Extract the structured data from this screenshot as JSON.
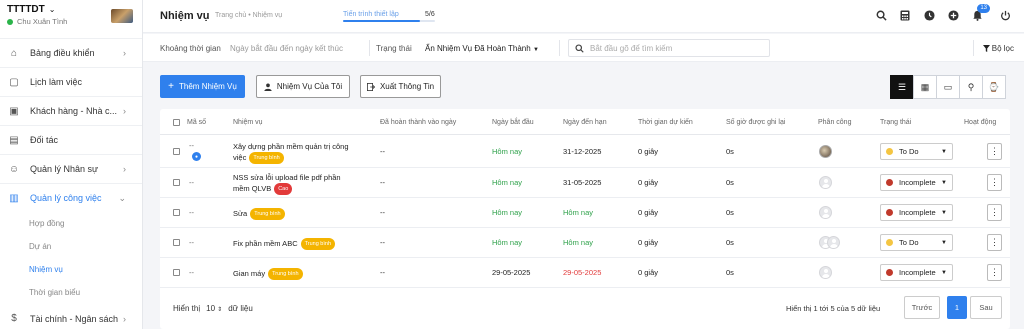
{
  "sidebar": {
    "org_name": "TTTTDT",
    "user_name": "Chu Xuân Tình",
    "items": [
      {
        "label": "Bảng điều khiển",
        "icon": "home-icon",
        "has_arrow": true
      },
      {
        "label": "Lịch làm việc",
        "icon": "calendar-icon",
        "has_arrow": false
      },
      {
        "label": "Khách hàng - Nhà c...",
        "icon": "contacts-icon",
        "has_arrow": true
      },
      {
        "label": "Đối tác",
        "icon": "partner-icon",
        "has_arrow": false
      },
      {
        "label": "Quản lý Nhân sự",
        "icon": "people-icon",
        "has_arrow": true
      },
      {
        "label": "Quản lý công việc",
        "icon": "briefcase-icon",
        "has_arrow": true
      }
    ],
    "sub_items": [
      {
        "label": "Hợp đồng"
      },
      {
        "label": "Dự án"
      },
      {
        "label": "Nhiệm vụ"
      },
      {
        "label": "Thời gian biểu"
      }
    ],
    "bottom_item": {
      "label": "Tài chính - Ngân sách",
      "icon": "dollar-icon"
    }
  },
  "header": {
    "title": "Nhiệm vụ",
    "breadcrumb": "Trang chủ • Nhiệm vụ",
    "progress_label": "Tiến trình thiết lập",
    "progress_count": "5/6",
    "progress_value": 0.833,
    "notification_count": "13"
  },
  "filter": {
    "time_label": "Khoảng thời gian",
    "date_placeholder": "Ngày bắt đầu đến ngày kết thúc",
    "status_label": "Trạng thái",
    "status_value": "Ẩn Nhiệm Vụ Đã Hoàn Thành",
    "search_placeholder": "Bắt đầu gõ để tìm kiếm",
    "filter_label": "Bộ lọc"
  },
  "actions": {
    "add": "Thêm Nhiệm Vụ",
    "mine": "Nhiệm Vụ Của Tôi",
    "export": "Xuất Thông Tin"
  },
  "table": {
    "headers": [
      "Mã số",
      "Nhiệm vụ",
      "Đã hoàn thành vào ngày",
      "Ngày bắt đầu",
      "Ngày đến hạn",
      "Thời gian dự kiến",
      "Số giờ được ghi lại",
      "Phân công",
      "Trạng thái",
      "Hoạt động"
    ],
    "rows": [
      {
        "code": "--",
        "name_1": "Xây dựng phần mềm quản trị công",
        "name_2": "việc",
        "tag": "Trung bình",
        "tag_color": "#f4b400",
        "done": "--",
        "start": "Hôm nay",
        "start_color": "#2ea14a",
        "due": "31-12-2025",
        "due_color": "#222222",
        "est": "0 giây",
        "hours": "0s",
        "status": "To Do",
        "status_color": "#f4c542",
        "assignee": "photo"
      },
      {
        "code": "--",
        "name_1": "NSS sửa lỗi upload file pdf phần",
        "name_2": "mềm QLVB",
        "tag": "Cao",
        "tag_color": "#e23a3a",
        "done": "--",
        "start": "Hôm nay",
        "start_color": "#2ea14a",
        "due": "31-05-2025",
        "due_color": "#222222",
        "est": "0 giây",
        "hours": "0s",
        "status": "Incomplete",
        "status_color": "#c0392b",
        "assignee": "single"
      },
      {
        "code": "--",
        "name_1": "Sửa",
        "name_2": "",
        "tag": "Trung bình",
        "tag_color": "#f4b400",
        "done": "--",
        "start": "Hôm nay",
        "start_color": "#2ea14a",
        "due": "Hôm nay",
        "due_color": "#2ea14a",
        "est": "0 giây",
        "hours": "0s",
        "status": "Incomplete",
        "status_color": "#c0392b",
        "assignee": "single"
      },
      {
        "code": "--",
        "name_1": "Fix phần mềm ABC",
        "name_2": "",
        "tag": "Trung bình",
        "tag_color": "#f4b400",
        "done": "--",
        "start": "Hôm nay",
        "start_color": "#2ea14a",
        "due": "Hôm nay",
        "due_color": "#2ea14a",
        "est": "0 giây",
        "hours": "0s",
        "status": "To Do",
        "status_color": "#f4c542",
        "assignee": "double"
      },
      {
        "code": "--",
        "name_1": "Gian máy",
        "name_2": "",
        "tag": "Trung bình",
        "tag_color": "#f4b400",
        "done": "--",
        "start": "29-05-2025",
        "start_color": "#222222",
        "due": "29-05-2025",
        "due_color": "#e23a3a",
        "est": "0 giây",
        "hours": "0s",
        "status": "Incomplete",
        "status_color": "#c0392b",
        "assignee": "single"
      }
    ]
  },
  "pagination": {
    "show_label": "Hiển thị",
    "page_size": "10",
    "entries_label": "dữ liệu",
    "summary": "Hiển thị 1 tới 5 của 5 dữ liệu",
    "prev": "Trước",
    "current": "1",
    "next": "Sau"
  },
  "colors": {
    "accent": "#2f80ed"
  }
}
